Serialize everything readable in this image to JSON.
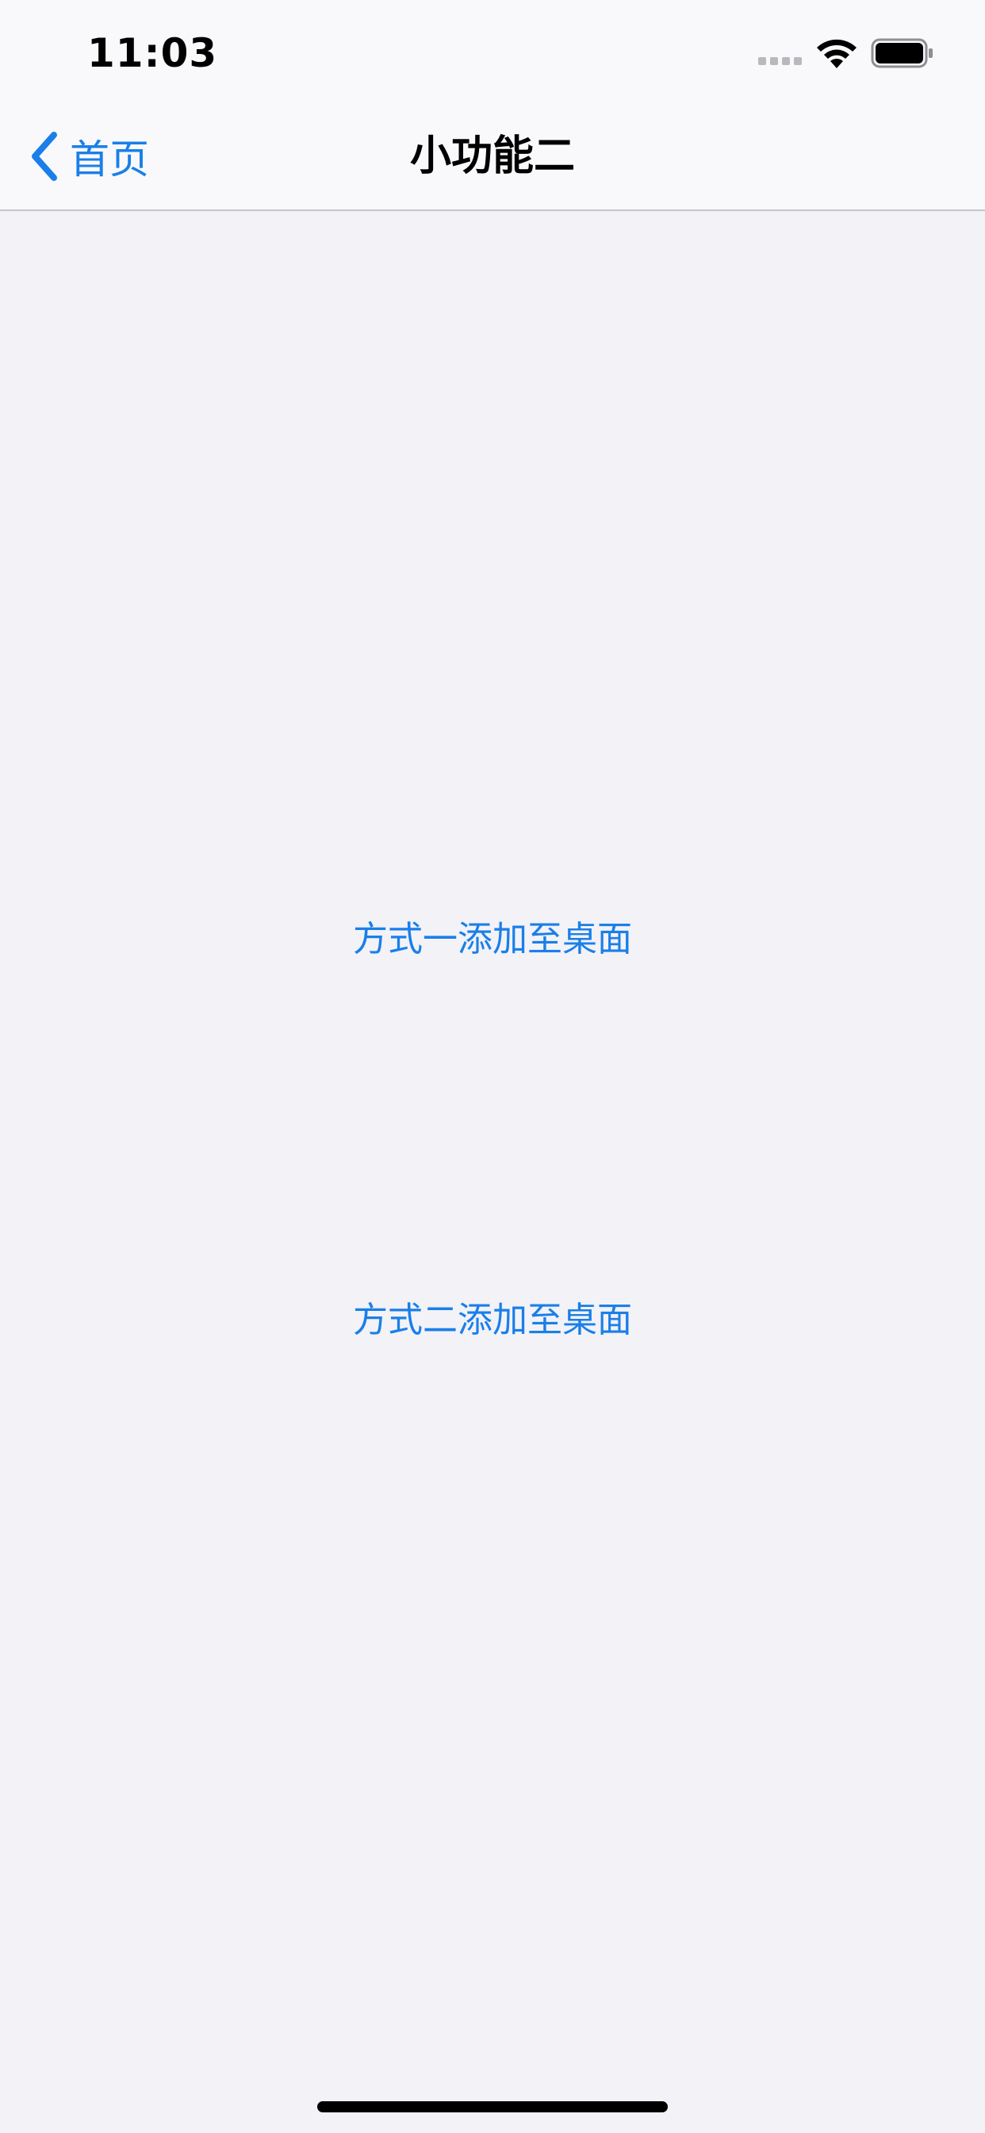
{
  "status_bar": {
    "time": "11:03",
    "cell_icon": "cellular-signal-icon",
    "wifi_icon": "wifi-icon",
    "battery_icon": "battery-icon"
  },
  "nav": {
    "back_label": "首页",
    "back_icon": "chevron-left-icon",
    "title": "小功能二"
  },
  "actions": [
    {
      "label": "方式一添加至桌面"
    },
    {
      "label": "方式二添加至桌面"
    }
  ],
  "colors": {
    "accent": "#1a7fe8",
    "background": "#f2f2f7",
    "bar_background": "#f9f9fb"
  }
}
